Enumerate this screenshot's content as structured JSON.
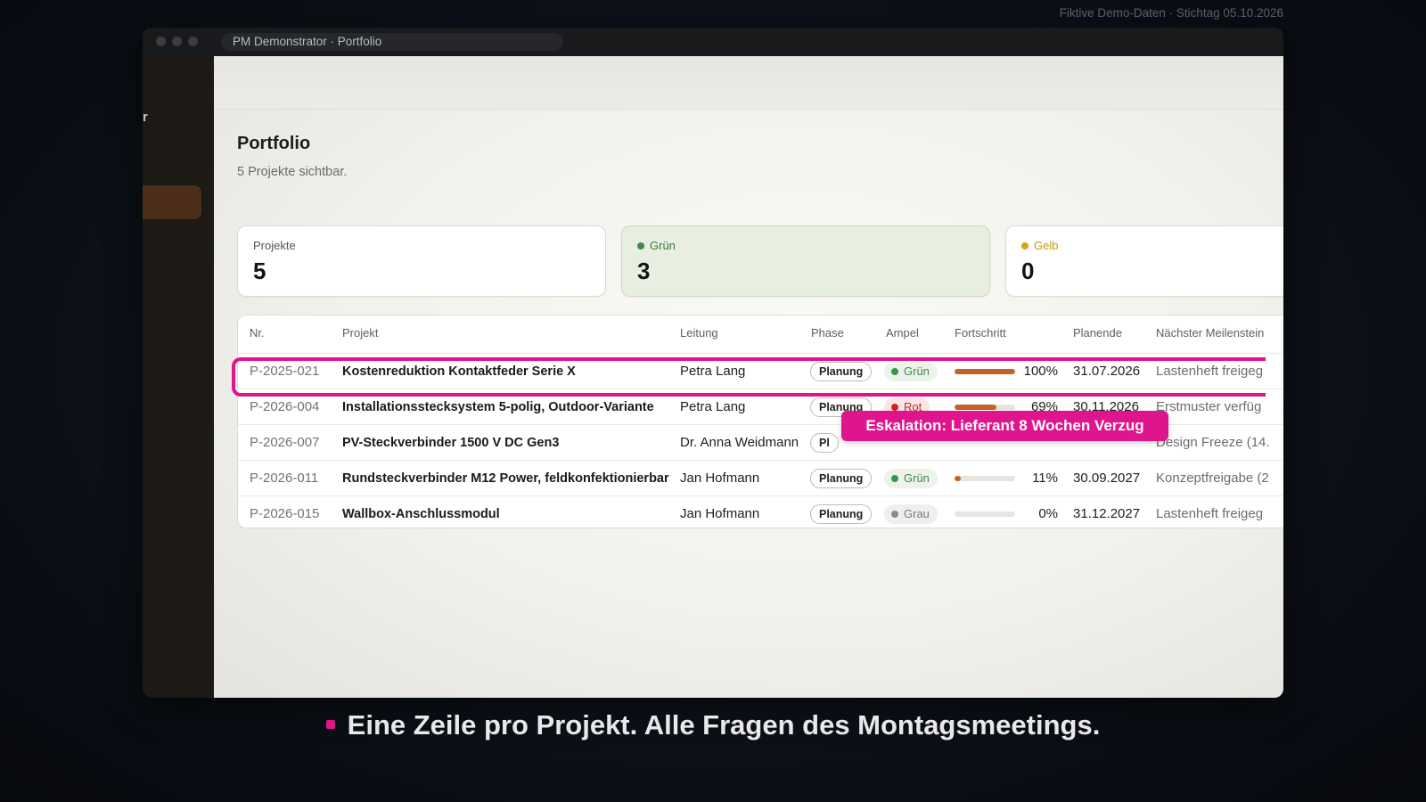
{
  "demo_note": "Fiktive Demo-Daten · Stichtag 05.10.2026",
  "window": {
    "title": "PM Demonstrator · Portfolio"
  },
  "sidebar": {
    "brand_fragment": "r"
  },
  "page": {
    "title": "Portfolio",
    "subtitle": "5 Projekte sichtbar."
  },
  "stats": [
    {
      "label": "Projekte",
      "value": "5"
    },
    {
      "label": "Grün",
      "value": "3",
      "color": "#3e8a4a"
    },
    {
      "label": "Gelb",
      "value": "0",
      "color": "#d8a40f"
    }
  ],
  "table": {
    "headers": [
      "Nr.",
      "Projekt",
      "Leitung",
      "Phase",
      "Ampel",
      "Fortschritt",
      "Planende",
      "Nächster Meilenstein"
    ],
    "rows": [
      {
        "nr": "P-2025-021",
        "projekt": "Kostenreduktion Kontaktfeder Serie X",
        "leitung": "Petra Lang",
        "phase": "Planung",
        "ampel": "Grün",
        "ampel_color": "#2f9a45",
        "progress": 100,
        "progress_label": "100%",
        "planende": "31.07.2026",
        "meilenstein": "Lastenheft freigeg"
      },
      {
        "nr": "P-2026-004",
        "projekt": "Installationsstecksystem 5-polig, Outdoor-Variante",
        "leitung": "Petra Lang",
        "phase": "Planung",
        "ampel": "Rot",
        "ampel_color": "#d61f2b",
        "progress": 69,
        "progress_label": "69%",
        "planende": "30.11.2026",
        "meilenstein": "Erstmuster verfüg"
      },
      {
        "nr": "P-2026-007",
        "projekt": "PV-Steckverbinder 1500 V DC Gen3",
        "leitung": "Dr. Anna Weidmann",
        "phase": "Pl",
        "ampel": "",
        "ampel_color": "",
        "progress": null,
        "progress_label": "",
        "planende": "",
        "meilenstein": "Design Freeze (14."
      },
      {
        "nr": "P-2026-011",
        "projekt": "Rundsteckverbinder M12 Power, feldkonfektionierbar",
        "leitung": "Jan Hofmann",
        "phase": "Planung",
        "ampel": "Grün",
        "ampel_color": "#2f9a45",
        "progress": 11,
        "progress_label": "11%",
        "planende": "30.09.2027",
        "meilenstein": "Konzeptfreigabe (2"
      },
      {
        "nr": "P-2026-015",
        "projekt": "Wallbox-Anschlussmodul",
        "leitung": "Jan Hofmann",
        "phase": "Planung",
        "ampel": "Grau",
        "ampel_color": "#8a8a8e",
        "progress": 0,
        "progress_label": "0%",
        "planende": "31.12.2027",
        "meilenstein": "Lastenheft freigeg"
      }
    ]
  },
  "escalation": "Eskalation: Lieferant 8 Wochen Verzug",
  "caption": "Eine Zeile pro Projekt. Alle Fragen des Montagsmeetings.",
  "colors": {
    "accent": "#e0148c",
    "progress": "#c5622a"
  }
}
